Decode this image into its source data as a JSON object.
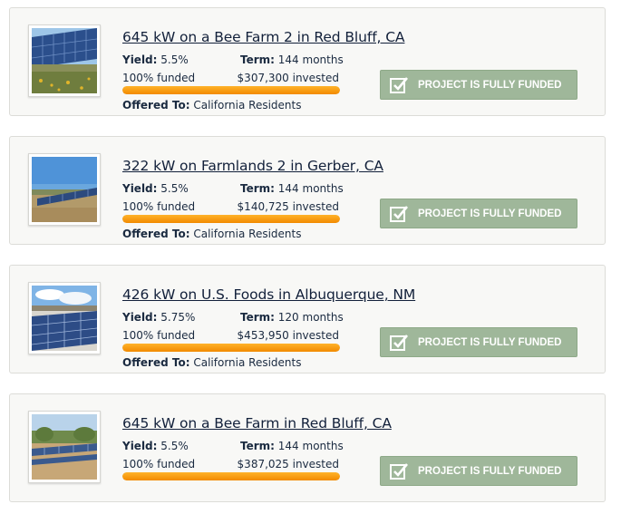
{
  "projects": [
    {
      "title": "645 kW on a Bee Farm 2 in Red Bluff, CA",
      "yield_label": "Yield:",
      "yield_value": "5.5%",
      "term_label": "Term:",
      "term_value": "144 months",
      "funded_text": "100% funded",
      "invested_text": "$307,300 invested",
      "funded_fraction": 1.0,
      "offered_label": "Offered To:",
      "offered_value": "California Residents",
      "button_label": "PROJECT IS FULLY FUNDED",
      "thumbnail_icon": "solar-field-with-flowers"
    },
    {
      "title": "322 kW on Farmlands 2 in Gerber, CA",
      "yield_label": "Yield:",
      "yield_value": "5.5%",
      "term_label": "Term:",
      "term_value": "144 months",
      "funded_text": "100% funded",
      "invested_text": "$140,725 invested",
      "funded_fraction": 1.0,
      "offered_label": "Offered To:",
      "offered_value": "California Residents",
      "button_label": "PROJECT IS FULLY FUNDED",
      "thumbnail_icon": "solar-field-farmland"
    },
    {
      "title": "426 kW on U.S. Foods in Albuquerque, NM",
      "yield_label": "Yield:",
      "yield_value": "5.75%",
      "term_label": "Term:",
      "term_value": "120 months",
      "funded_text": "100% funded",
      "invested_text": "$453,950 invested",
      "funded_fraction": 1.0,
      "offered_label": "Offered To:",
      "offered_value": "California Residents",
      "button_label": "PROJECT IS FULLY FUNDED",
      "thumbnail_icon": "rooftop-solar-panels"
    },
    {
      "title": "645 kW on a Bee Farm in Red Bluff, CA",
      "yield_label": "Yield:",
      "yield_value": "5.5%",
      "term_label": "Term:",
      "term_value": "144 months",
      "funded_text": "100% funded",
      "invested_text": "$387,025 invested",
      "funded_fraction": 1.0,
      "offered_label": "",
      "offered_value": "",
      "button_label": "PROJECT IS FULLY FUNDED",
      "thumbnail_icon": "solar-field-dirt"
    }
  ],
  "colors": {
    "button_bg": "#9fb79a",
    "progress_fill": "#f39a10",
    "card_bg": "#f8f8f6",
    "title_text": "#12203a"
  }
}
